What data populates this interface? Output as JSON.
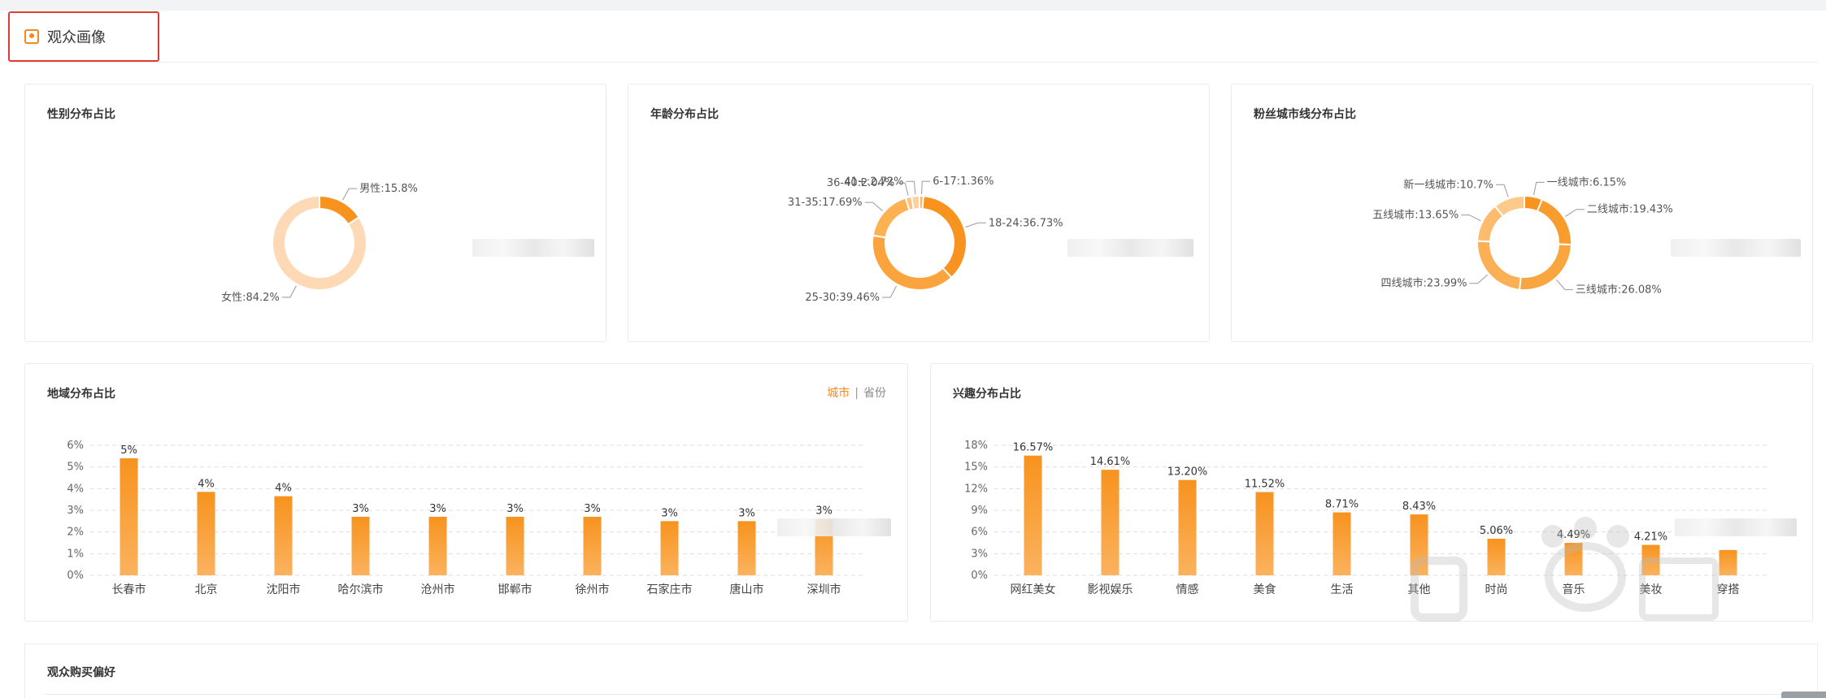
{
  "header": {
    "title": "观众画像",
    "icon": "user-portrait-icon"
  },
  "gender": {
    "title": "性别分布占比",
    "chart_data": {
      "type": "pie",
      "donut": true,
      "slices": [
        {
          "label": "男性:15.8%",
          "value": 15.8,
          "color": "#f7931e"
        },
        {
          "label": "女性:84.2%",
          "value": 84.2,
          "color": "#fdd9b5"
        }
      ]
    }
  },
  "age": {
    "title": "年龄分布占比",
    "chart_data": {
      "type": "pie",
      "donut": true,
      "slices": [
        {
          "label": "6-17:1.36%",
          "value": 1.36,
          "color": "#fbb464"
        },
        {
          "label": "18-24:36.73%",
          "value": 36.73,
          "color": "#f7931e"
        },
        {
          "label": "25-30:39.46%",
          "value": 39.46,
          "color": "#fba43e"
        },
        {
          "label": "31-35:17.69%",
          "value": 17.69,
          "color": "#fcb152"
        },
        {
          "label": "36-40:2.04%",
          "value": 2.04,
          "color": "#fcc07a"
        },
        {
          "label": "41+:2.72%",
          "value": 2.72,
          "color": "#fdd09c"
        }
      ]
    }
  },
  "city_tier": {
    "title": "粉丝城市线分布占比",
    "chart_data": {
      "type": "pie",
      "donut": true,
      "slices": [
        {
          "label": "一线城市:6.15%",
          "value": 6.15,
          "color": "#f7931e"
        },
        {
          "label": "二线城市:19.43%",
          "value": 19.43,
          "color": "#f89c2e"
        },
        {
          "label": "三线城市:26.08%",
          "value": 26.08,
          "color": "#faa640"
        },
        {
          "label": "四线城市:23.99%",
          "value": 23.99,
          "color": "#fbb055"
        },
        {
          "label": "五线城市:13.65%",
          "value": 13.65,
          "color": "#fcbc6e"
        },
        {
          "label": "新一线城市:10.7%",
          "value": 10.7,
          "color": "#fdca8c"
        }
      ]
    }
  },
  "region": {
    "title": "地域分布占比",
    "toggle": {
      "active": "城市",
      "separator": "|",
      "inactive": "省份"
    },
    "chart_data": {
      "type": "bar",
      "categories": [
        "长春市",
        "北京",
        "沈阳市",
        "哈尔滨市",
        "沧州市",
        "邯郸市",
        "徐州市",
        "石家庄市",
        "唐山市",
        "深圳市"
      ],
      "values": [
        5.4,
        3.85,
        3.65,
        2.7,
        2.7,
        2.7,
        2.7,
        2.5,
        2.5,
        2.6
      ],
      "value_labels": [
        "5%",
        "4%",
        "4%",
        "3%",
        "3%",
        "3%",
        "3%",
        "3%",
        "3%",
        "3%"
      ],
      "yticks": [
        "0%",
        "1%",
        "2%",
        "3%",
        "4%",
        "5%",
        "6%"
      ],
      "ylim": [
        0,
        6
      ],
      "color": "#f7931e"
    }
  },
  "interest": {
    "title": "兴趣分布占比",
    "chart_data": {
      "type": "bar",
      "categories": [
        "网红美女",
        "影视娱乐",
        "情感",
        "美食",
        "生活",
        "其他",
        "时尚",
        "音乐",
        "美妆",
        "穿搭"
      ],
      "values": [
        16.57,
        14.61,
        13.2,
        11.52,
        8.71,
        8.43,
        5.06,
        4.49,
        4.21,
        3.5
      ],
      "value_labels": [
        "16.57%",
        "14.61%",
        "13.20%",
        "11.52%",
        "8.71%",
        "8.43%",
        "5.06%",
        "4.49%",
        "4.21%",
        ""
      ],
      "yticks": [
        "0%",
        "3%",
        "6%",
        "9%",
        "12%",
        "15%",
        "18%"
      ],
      "ylim": [
        0,
        18
      ],
      "color": "#f7931e"
    }
  },
  "purchase": {
    "title": "观众购买偏好"
  }
}
